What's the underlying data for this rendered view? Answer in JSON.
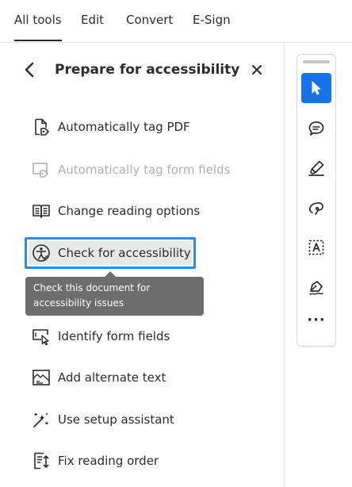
{
  "top_tabs": [
    {
      "label": "All tools",
      "active": true
    },
    {
      "label": "Edit",
      "active": false
    },
    {
      "label": "Convert",
      "active": false
    },
    {
      "label": "E-Sign",
      "active": false
    }
  ],
  "panel": {
    "title": "Prepare for accessibility",
    "back_icon": "chevron-left-icon",
    "close_icon": "close-icon",
    "items": [
      {
        "label": "Automatically tag PDF",
        "icon": "auto-tag-pdf-icon",
        "state": "enabled"
      },
      {
        "label": "Automatically tag form fields",
        "icon": "auto-tag-form-fields-icon",
        "state": "disabled"
      },
      {
        "label": "Change reading options",
        "icon": "reading-options-icon",
        "state": "enabled"
      },
      {
        "label": "Check for accessibility",
        "icon": "accessibility-check-icon",
        "state": "focused"
      },
      {
        "label": "Identify form fields",
        "icon": "identify-form-fields-icon",
        "state": "enabled"
      },
      {
        "label": "Add alternate text",
        "icon": "alternate-text-icon",
        "state": "enabled"
      },
      {
        "label": "Use setup assistant",
        "icon": "setup-assistant-icon",
        "state": "enabled"
      },
      {
        "label": "Fix reading order",
        "icon": "reading-order-icon",
        "state": "enabled"
      }
    ]
  },
  "tooltip": {
    "line1": "Check this document for",
    "line2": "accessibility issues"
  },
  "toolbar": {
    "buttons": [
      {
        "icon": "pointer-icon",
        "selected": true
      },
      {
        "icon": "comment-icon",
        "selected": false
      },
      {
        "icon": "highlighter-icon",
        "selected": false
      },
      {
        "icon": "freehand-draw-icon",
        "selected": false
      },
      {
        "icon": "text-box-icon",
        "selected": false
      },
      {
        "icon": "signature-pen-icon",
        "selected": false
      }
    ],
    "more_label": "···"
  },
  "colors": {
    "accent": "#1473e6",
    "focus_ring": "#2d8ceb",
    "tooltip_bg": "#6d6d6d",
    "disabled_text": "#b0b0b0"
  }
}
